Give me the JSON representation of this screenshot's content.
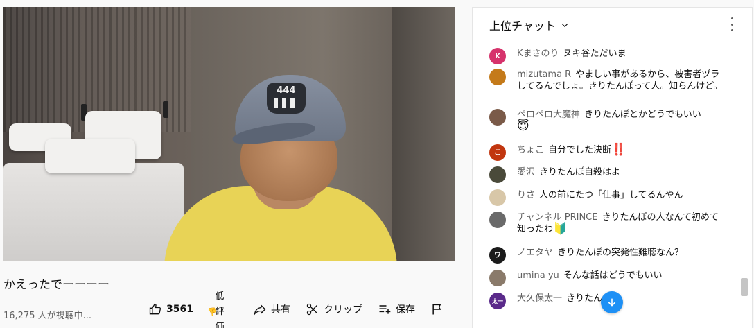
{
  "video": {
    "cap_text": "444"
  },
  "title": "かえったでーーーー",
  "viewers": "16,275 人が視聴中...",
  "actions": {
    "like_count": "3561",
    "dislike_line1": "低",
    "dislike_line2": "評",
    "dislike_line3": "価",
    "share": "共有",
    "clip": "クリップ",
    "save": "保存"
  },
  "chat": {
    "header": "上位チャット",
    "messages": [
      {
        "author": "Kまさのり",
        "text": "ヌキ谷ただいま",
        "avatar_letter": "K",
        "avatar_color": "#d6336c"
      },
      {
        "author": "mizutama R",
        "text": "やましい事があるから、被害者ヅラしてるんでしょ。きりたんぽって人。知らんけど。",
        "avatar_letter": "",
        "avatar_color": "#c47a1a"
      },
      {
        "author": "ペロペロ大魔神",
        "text": "きりたんぽとかどうでもいい",
        "avatar_letter": "",
        "avatar_color": "#7a5a48",
        "emoji": "😇"
      },
      {
        "author": "ちょこ",
        "text": "自分でした決断",
        "avatar_letter": "こ",
        "avatar_color": "#c1360f",
        "emoji": "‼️"
      },
      {
        "author": "愛沢",
        "text": "きりたんぽ自殺はよ",
        "avatar_letter": "",
        "avatar_color": "#4a4a3a"
      },
      {
        "author": "りさ",
        "text": "人の前にたつ「仕事」してるんやん",
        "avatar_letter": "",
        "avatar_color": "#d8c7a8"
      },
      {
        "author": "チャンネル PRINCE",
        "text": "きりたんぽの人なんて初めて知ったわ",
        "avatar_letter": "",
        "avatar_color": "#6a6a6a",
        "emoji": "🔰"
      },
      {
        "author": "ノエタヤ",
        "text": "きりたんぽの突発性難聴なん？",
        "avatar_letter": "ワ",
        "avatar_color": "#1b1b1b"
      },
      {
        "author": "umina yu",
        "text": "そんな話はどうでもいい",
        "avatar_letter": "",
        "avatar_color": "#8a7a6a"
      },
      {
        "author": "大久保太一",
        "text": "きりたん",
        "avatar_letter": "太一",
        "avatar_color": "#5a2a8a"
      }
    ]
  },
  "colors": {
    "accent_blue": "#1e90f5",
    "text_secondary": "#606060"
  }
}
